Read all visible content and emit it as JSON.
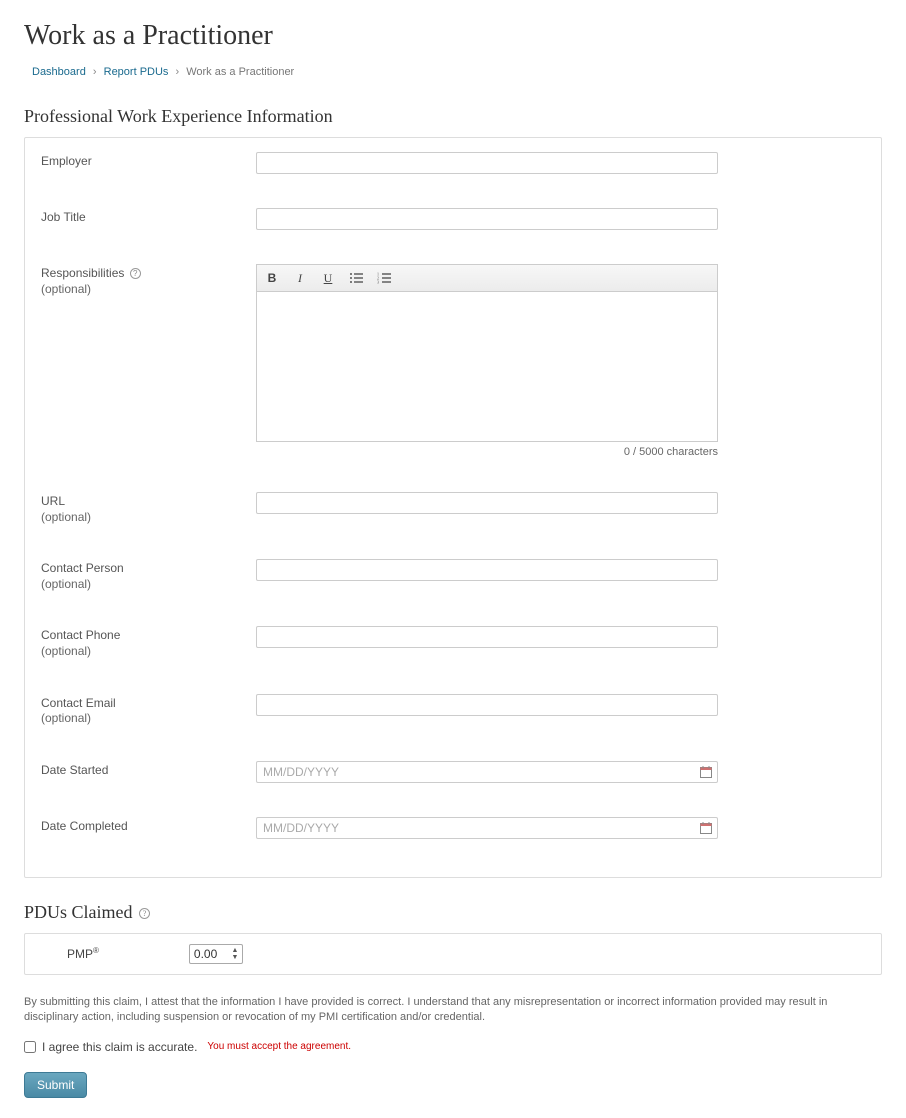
{
  "page": {
    "title": "Work as a Practitioner"
  },
  "breadcrumb": {
    "items": [
      {
        "label": "Dashboard",
        "link": true
      },
      {
        "label": "Report PDUs",
        "link": true
      },
      {
        "label": "Work as a Practitioner",
        "link": false
      }
    ]
  },
  "sections": {
    "experience": {
      "title": "Professional Work Experience Information",
      "fields": {
        "employer": {
          "label": "Employer",
          "value": ""
        },
        "job_title": {
          "label": "Job Title",
          "value": ""
        },
        "responsibilities": {
          "label": "Responsibilities",
          "sub": "(optional)",
          "value": "",
          "counter": "0 / 5000 characters"
        },
        "url": {
          "label": "URL",
          "sub": "(optional)",
          "value": ""
        },
        "contact_person": {
          "label": "Contact Person",
          "sub": "(optional)",
          "value": ""
        },
        "contact_phone": {
          "label": "Contact Phone",
          "sub": "(optional)",
          "value": ""
        },
        "contact_email": {
          "label": "Contact Email",
          "sub": "(optional)",
          "value": ""
        },
        "date_started": {
          "label": "Date Started",
          "placeholder": "MM/DD/YYYY",
          "value": ""
        },
        "date_completed": {
          "label": "Date Completed",
          "placeholder": "MM/DD/YYYY",
          "value": ""
        }
      }
    },
    "pdus": {
      "title": "PDUs Claimed",
      "cert_label": "PMP",
      "value": "0.00"
    }
  },
  "attestation": {
    "text": "By submitting this claim, I attest that the information I have provided is correct. I understand that any misrepresentation or incorrect information provided may result in disciplinary action, including suspension or revocation of my PMI certification and/or credential."
  },
  "agreement": {
    "label": "I agree this claim is accurate.",
    "error": "You must accept the agreement.",
    "checked": false
  },
  "buttons": {
    "submit": "Submit"
  }
}
